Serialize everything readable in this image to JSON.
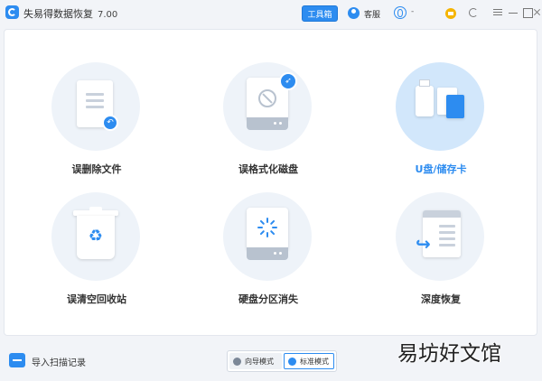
{
  "app": {
    "title": "失易得数据恢复",
    "version": "7.00"
  },
  "titlebar": {
    "tools_label": "工具箱",
    "customer_service_label": "客服",
    "account_label": "-"
  },
  "options": [
    {
      "label": "误删除文件",
      "icon": "deleted-file-icon",
      "active": false
    },
    {
      "label": "误格式化磁盘",
      "icon": "formatted-disk-icon",
      "active": false
    },
    {
      "label": "U盘/储存卡",
      "icon": "usb-card-icon",
      "active": true
    },
    {
      "label": "误清空回收站",
      "icon": "recycle-bin-icon",
      "active": false
    },
    {
      "label": "硬盘分区消失",
      "icon": "lost-partition-icon",
      "active": false
    },
    {
      "label": "深度恢复",
      "icon": "deep-recovery-icon",
      "active": false
    }
  ],
  "footer": {
    "import_label": "导入扫描记录",
    "mode_guide": "向导模式",
    "mode_standard": "标准模式",
    "selected_mode": "标准模式"
  },
  "watermark": "易坊好文馆",
  "colors": {
    "accent": "#2d8cf0",
    "active_circle": "#d2e7fb",
    "inactive_circle": "#eef3f9"
  }
}
